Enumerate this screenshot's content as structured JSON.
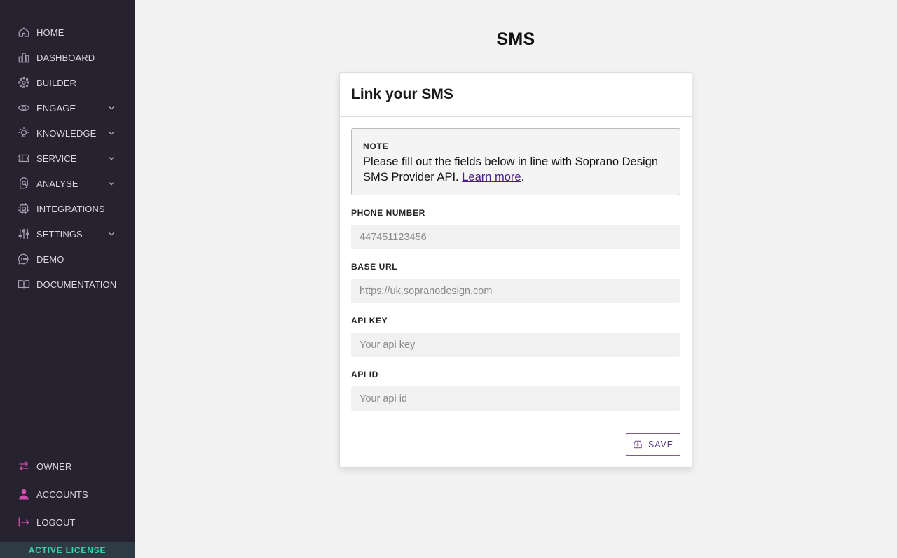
{
  "sidebar": {
    "items": [
      {
        "label": "HOME",
        "icon": "home-icon",
        "expandable": false
      },
      {
        "label": "DASHBOARD",
        "icon": "bar-chart-icon",
        "expandable": false
      },
      {
        "label": "BUILDER",
        "icon": "builder-icon",
        "expandable": false
      },
      {
        "label": "ENGAGE",
        "icon": "eye-icon",
        "expandable": true
      },
      {
        "label": "KNOWLEDGE",
        "icon": "lightbulb-icon",
        "expandable": true
      },
      {
        "label": "SERVICE",
        "icon": "ticket-icon",
        "expandable": true
      },
      {
        "label": "ANALYSE",
        "icon": "analyse-icon",
        "expandable": true
      },
      {
        "label": "INTEGRATIONS",
        "icon": "chip-icon",
        "expandable": false
      },
      {
        "label": "SETTINGS",
        "icon": "sliders-icon",
        "expandable": true
      },
      {
        "label": "DEMO",
        "icon": "chat-bubble-icon",
        "expandable": false
      },
      {
        "label": "DOCUMENTATION",
        "icon": "book-icon",
        "expandable": false
      }
    ],
    "bottom_items": [
      {
        "label": "OWNER",
        "icon": "swap-arrows-icon"
      },
      {
        "label": "ACCOUNTS",
        "icon": "person-icon"
      },
      {
        "label": "LOGOUT",
        "icon": "logout-icon"
      }
    ],
    "license_label": "ACTIVE LICENSE",
    "accent_color": "#d34fae",
    "license_color": "#3fd0b0"
  },
  "page": {
    "title": "SMS"
  },
  "card": {
    "title": "Link your SMS",
    "note": {
      "label": "NOTE",
      "text": "Please fill out the fields below in line with Soprano Design SMS Provider API.",
      "link_text": "Learn more",
      "suffix": "."
    },
    "fields": [
      {
        "label": "PHONE NUMBER",
        "placeholder": "447451123456",
        "value": ""
      },
      {
        "label": "BASE URL",
        "placeholder": "https://uk.sopranodesign.com",
        "value": ""
      },
      {
        "label": "API KEY",
        "placeholder": "Your api key",
        "value": ""
      },
      {
        "label": "API ID",
        "placeholder": "Your api id",
        "value": ""
      }
    ],
    "save_label": "SAVE",
    "save_icon": "save-icon"
  }
}
